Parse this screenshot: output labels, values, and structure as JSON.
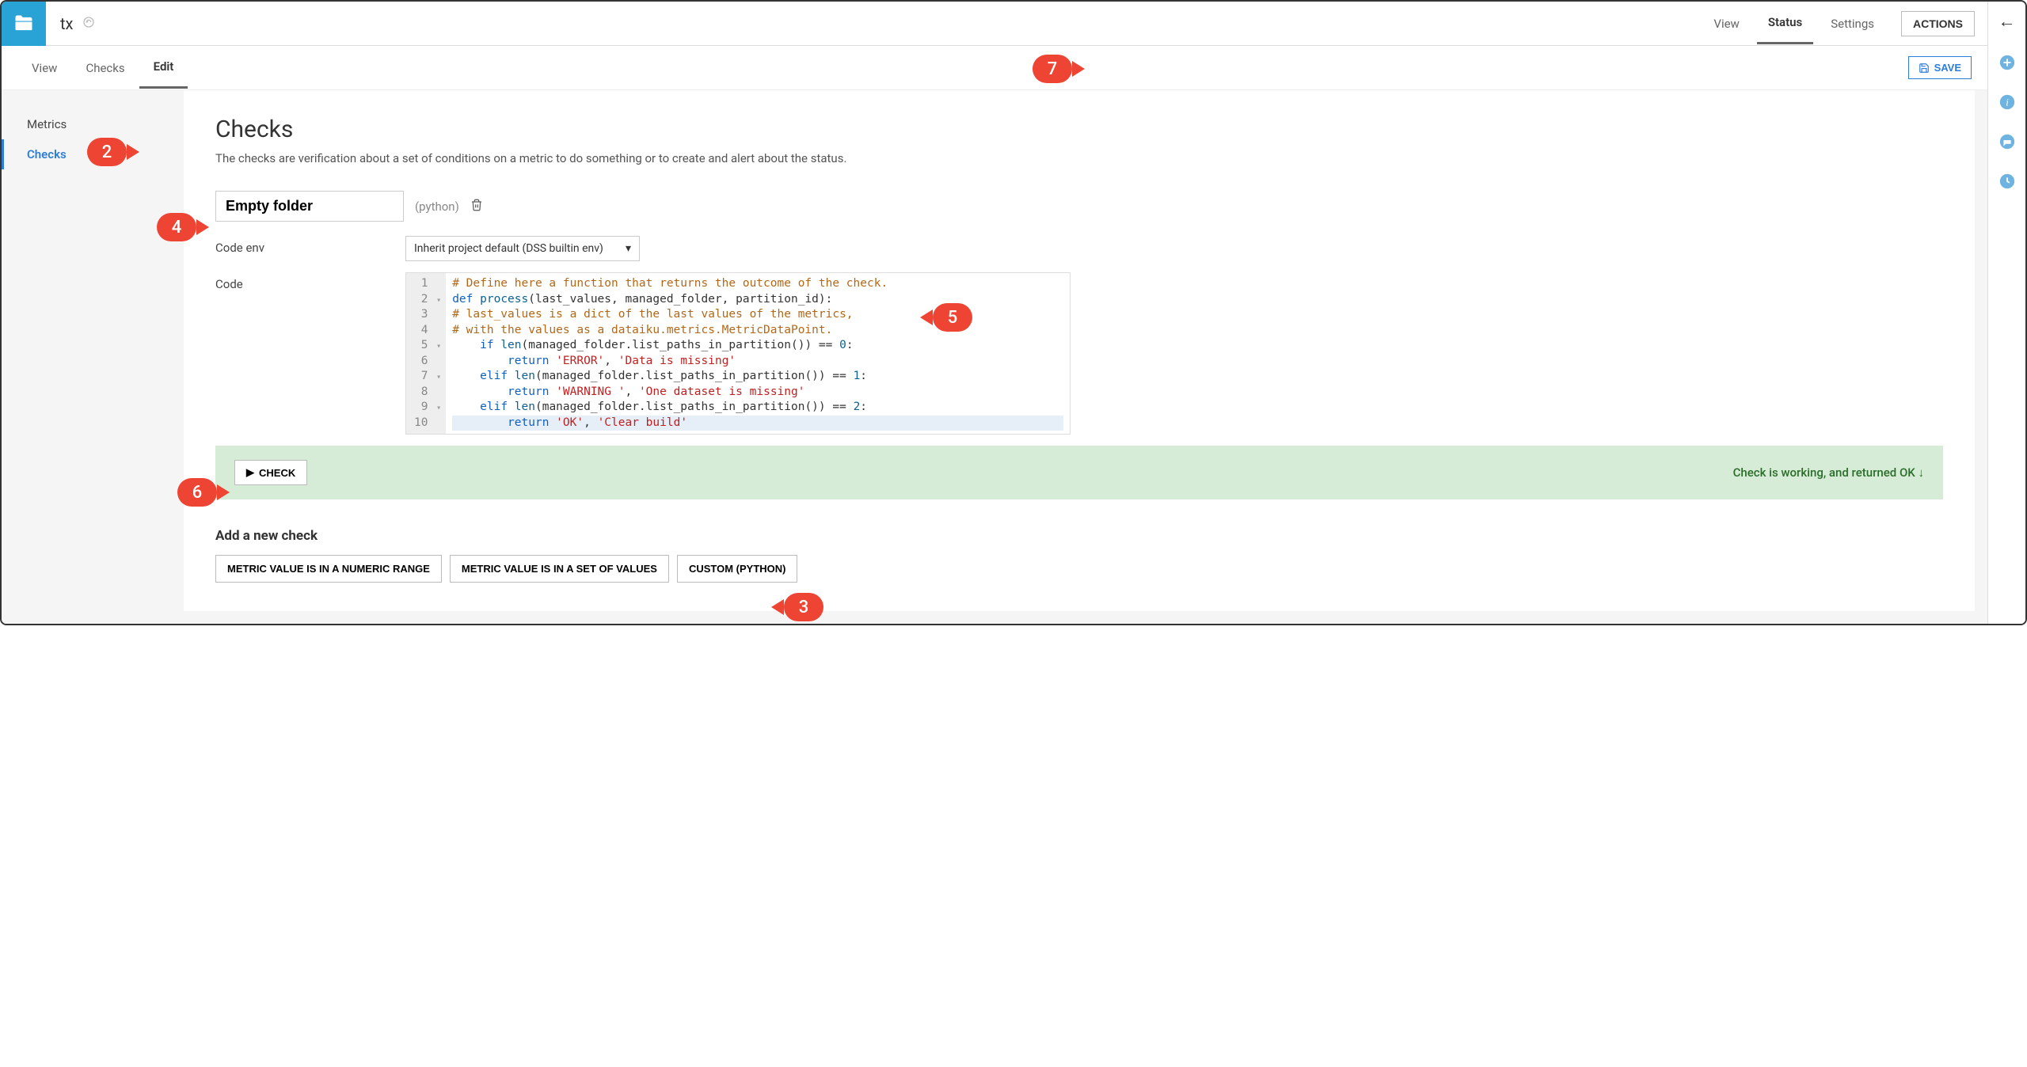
{
  "header": {
    "title": "tx",
    "nav": [
      "View",
      "Status",
      "Settings"
    ],
    "nav_active": "Status",
    "actions_label": "ACTIONS"
  },
  "subnav": {
    "items": [
      "View",
      "Checks",
      "Edit"
    ],
    "active": "Edit",
    "save_label": "SAVE"
  },
  "sidebar": {
    "items": [
      "Metrics",
      "Checks"
    ],
    "active": "Checks"
  },
  "panel": {
    "title": "Checks",
    "description": "The checks are verification about a set of conditions on a metric to do something or to create and alert about the status."
  },
  "check": {
    "name": "Empty folder",
    "language": "(python)",
    "code_env_label": "Code env",
    "code_env_value": "Inherit project default (DSS builtin env)",
    "code_label": "Code",
    "code_lines": [
      {
        "n": "1",
        "fold": "",
        "text": "# Define here a function that returns the outcome of the check.",
        "cls": "comment"
      },
      {
        "n": "2",
        "fold": "▾",
        "text": "def process(last_values, managed_folder, partition_id):",
        "cls": "def"
      },
      {
        "n": "3",
        "fold": "",
        "text": "# last_values is a dict of the last values of the metrics,",
        "cls": "comment"
      },
      {
        "n": "4",
        "fold": "",
        "text": "# with the values as a dataiku.metrics.MetricDataPoint.",
        "cls": "comment"
      },
      {
        "n": "5",
        "fold": "▾",
        "text": "    if len(managed_folder.list_paths_in_partition()) == 0:",
        "cls": "code"
      },
      {
        "n": "6",
        "fold": "",
        "text": "        return 'ERROR', 'Data is missing'",
        "cls": "ret"
      },
      {
        "n": "7",
        "fold": "▾",
        "text": "    elif len(managed_folder.list_paths_in_partition()) == 1:",
        "cls": "code"
      },
      {
        "n": "8",
        "fold": "",
        "text": "        return 'WARNING ', 'One dataset is missing'",
        "cls": "ret"
      },
      {
        "n": "9",
        "fold": "▾",
        "text": "    elif len(managed_folder.list_paths_in_partition()) == 2:",
        "cls": "code"
      },
      {
        "n": "10",
        "fold": "",
        "text": "        return 'OK', 'Clear build'",
        "cls": "ret",
        "hl": true
      }
    ],
    "run_button": "CHECK",
    "result_text": "Check is working, and returned OK"
  },
  "add": {
    "title": "Add a new check",
    "buttons": [
      "METRIC VALUE IS IN A NUMERIC RANGE",
      "METRIC VALUE IS IN A SET OF VALUES",
      "CUSTOM (PYTHON)"
    ]
  },
  "callouts": {
    "c2": "2",
    "c3": "3",
    "c4": "4",
    "c5": "5",
    "c6": "6",
    "c7": "7"
  }
}
